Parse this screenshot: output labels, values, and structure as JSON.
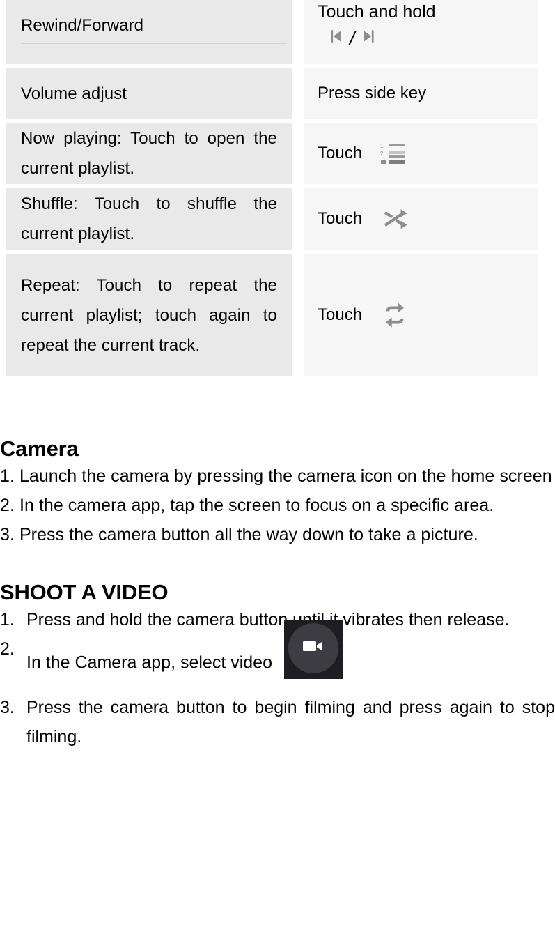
{
  "table": {
    "rows": [
      {
        "action": "Rewind/Forward",
        "gesture_line1": "Touch and hold",
        "gesture_icons": [
          "previous-track-icon",
          "next-track-icon"
        ],
        "separator": "/"
      },
      {
        "action": "Volume adjust",
        "gesture_line1": "Press side key"
      },
      {
        "action": "Now playing: Touch to open the current playlist.",
        "gesture_line1": "Touch",
        "gesture_icons": [
          "playlist-icon"
        ]
      },
      {
        "action": "Shuffle: Touch to shuffle the current playlist.",
        "gesture_line1": "Touch",
        "gesture_icons": [
          "shuffle-icon"
        ]
      },
      {
        "action": "Repeat: Touch to repeat the current playlist; touch again to repeat the current track.",
        "gesture_line1": "Touch",
        "gesture_icons": [
          "repeat-icon"
        ]
      }
    ]
  },
  "camera": {
    "heading": "Camera",
    "steps": [
      "1. Launch the camera by pressing the camera icon on the home screen",
      "2. In the camera app, tap the screen to focus on a specific area.",
      "3. Press the camera button all the way down to take a picture."
    ]
  },
  "shoot_video": {
    "heading": "SHOOT A VIDEO",
    "steps": [
      {
        "num": "1.",
        "text": "Press and hold the camera button until it vibrates then release."
      },
      {
        "num": "2.",
        "text": "In the Camera app, select video",
        "icon": "video-camera-button-icon"
      },
      {
        "num": "3.",
        "text": "Press the camera button to begin filming and press again to stop filming."
      }
    ]
  },
  "colors": {
    "cell_left_bg": "#e9e9e9",
    "cell_right_bg": "#f6f6f6",
    "icon_gray": "#8a8a8a",
    "video_button_bg": "#1e1e22",
    "video_button_circle": "#3c3c42",
    "text": "#000000"
  }
}
